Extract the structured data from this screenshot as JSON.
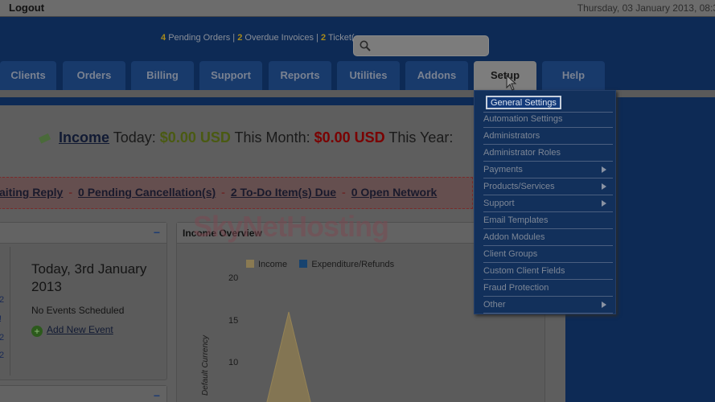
{
  "topbar": {
    "logout": "Logout",
    "date": "Thursday, 03 January 2013, 08:3"
  },
  "alerts": {
    "pending_orders_count": "4",
    "pending_orders_label": "Pending Orders",
    "overdue_count": "2",
    "overdue_label": "Overdue Invoices",
    "tickets_count": "2",
    "tickets_label": "Ticket(",
    "sep": "|"
  },
  "search": {
    "placeholder": ""
  },
  "tabs": [
    "Clients",
    "Orders",
    "Billing",
    "Support",
    "Reports",
    "Utilities",
    "Addons",
    "Setup",
    "Help"
  ],
  "income": {
    "link": "Income",
    "today_label": "Today:",
    "today_value": "$0.00 USD",
    "month_label": "This Month:",
    "month_value": "$0.00 USD",
    "year_label": "This Year:"
  },
  "status": {
    "awaiting": "aiting Reply",
    "cancellations": "0 Pending Cancellation(s)",
    "todo": "2 To-Do Item(s) Due",
    "network": "0 Open Network",
    "sep": "-"
  },
  "calendar": {
    "today_text": "Today, 3rd January 2013",
    "no_events": "No Events Scheduled",
    "add_event": "Add New Event",
    "side_marks": [
      "2",
      "!",
      "2",
      "2"
    ]
  },
  "overview": {
    "title": "Income Overview",
    "legend_income": "Income",
    "legend_expenditure": "Expenditure/Refunds",
    "ylabel": "Default Currency",
    "ticks": [
      "20",
      "15",
      "10"
    ],
    "income_color": "#8a7a52",
    "expenditure_color": "#17436f"
  },
  "watermark": "SkyNetHosting",
  "setup_menu": [
    {
      "label": "General Settings",
      "submenu": false
    },
    {
      "label": "Automation Settings",
      "submenu": false
    },
    {
      "label": "Administrators",
      "submenu": false
    },
    {
      "label": "Administrator Roles",
      "submenu": false
    },
    {
      "label": "Payments",
      "submenu": true
    },
    {
      "label": "Products/Services",
      "submenu": true
    },
    {
      "label": "Support",
      "submenu": true
    },
    {
      "label": "Email Templates",
      "submenu": false
    },
    {
      "label": "Addon Modules",
      "submenu": false
    },
    {
      "label": "Client Groups",
      "submenu": false
    },
    {
      "label": "Custom Client Fields",
      "submenu": false
    },
    {
      "label": "Fraud Protection",
      "submenu": false
    },
    {
      "label": "Other",
      "submenu": true
    }
  ]
}
